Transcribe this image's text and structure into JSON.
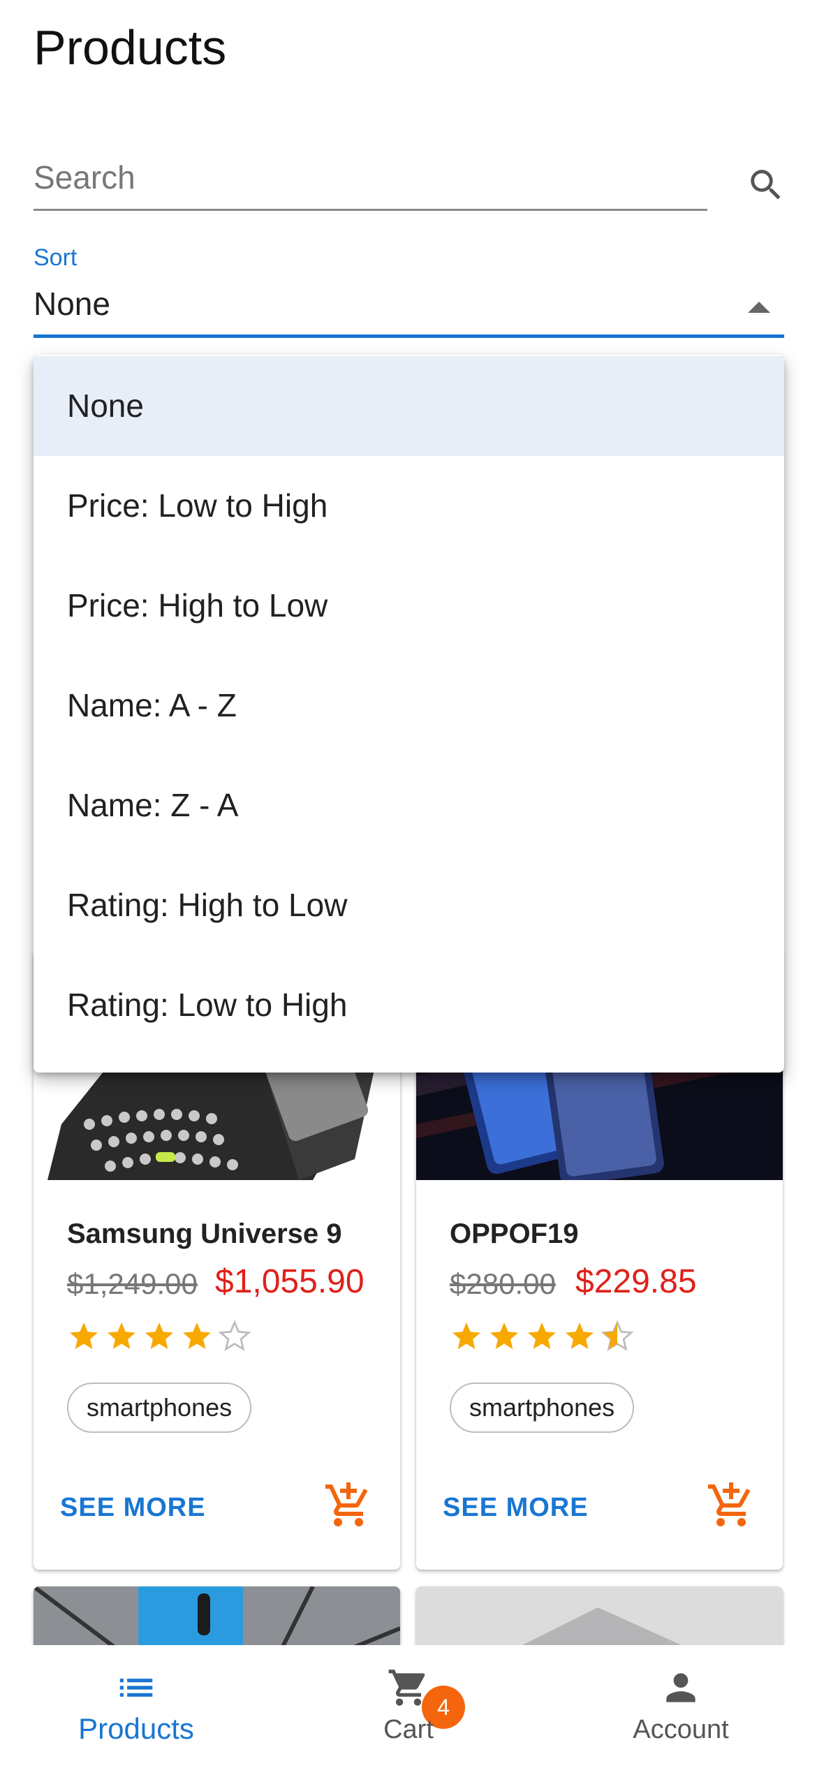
{
  "header": {
    "title": "Products"
  },
  "search": {
    "placeholder": "Search"
  },
  "sort": {
    "label": "Sort",
    "selected": "None",
    "options": [
      "None",
      "Price: Low to High",
      "Price: High to Low",
      "Name: A - Z",
      "Name: Z - A",
      "Rating: High to Low",
      "Rating: Low to High"
    ]
  },
  "products": [
    {
      "name": "Samsung Universe 9",
      "old_price": "$1,249.00",
      "price": "$1,055.90",
      "rating": 4,
      "category": "smartphones",
      "action": "SEE MORE"
    },
    {
      "name": "OPPOF19",
      "old_price": "$280.00",
      "price": "$229.85",
      "rating": 4.5,
      "category": "smartphones",
      "action": "SEE MORE"
    }
  ],
  "colors": {
    "accent": "#1976d2",
    "sale_price": "#e0201a",
    "star": "#f7a900",
    "cart_icon": "#f4650d"
  },
  "bottom_nav": {
    "items": [
      {
        "label": "Products",
        "icon": "list-icon",
        "active": true
      },
      {
        "label": "Cart",
        "icon": "cart-icon",
        "badge": "4"
      },
      {
        "label": "Account",
        "icon": "person-icon"
      }
    ]
  }
}
